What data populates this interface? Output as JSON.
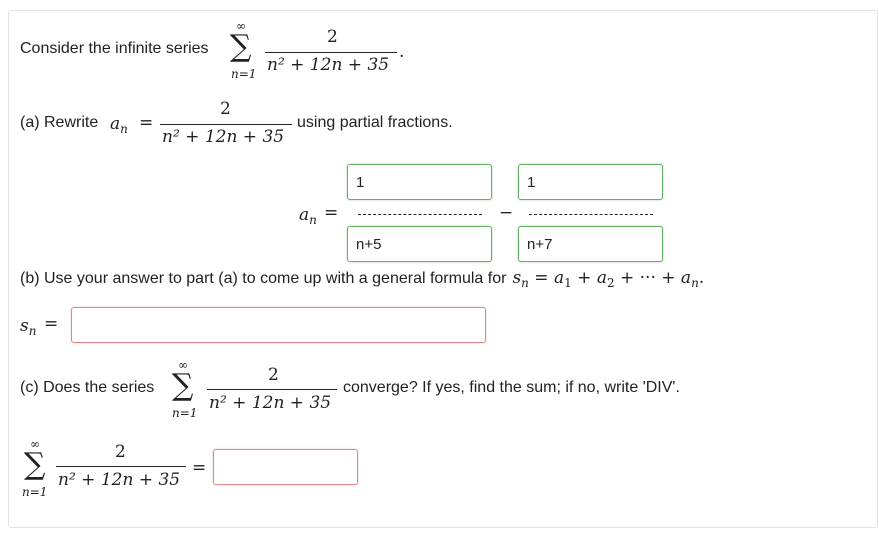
{
  "problem": {
    "intro_text": "Consider the infinite series",
    "series": {
      "sigma": "∑",
      "upper": "∞",
      "lower": "n=1",
      "numerator": "2",
      "denominator": "n² + 12n + 35"
    },
    "period": "."
  },
  "part_a": {
    "label": "(a) Rewrite",
    "a": "a",
    "n": "n",
    "equals": "=",
    "numerator": "2",
    "denominator": "n² + 12n + 35",
    "suffix": "using partial fractions.",
    "minus": "−",
    "inputs": {
      "num1": "1",
      "den1": "n+5",
      "num2": "1",
      "den2": "n+7"
    }
  },
  "part_b": {
    "text": "(b) Use your answer to part (a) to come up with a general formula for",
    "formula": "s",
    "formula_rest": " = a",
    "sn_label": "s",
    "equals": "=",
    "answer": ""
  },
  "part_c": {
    "prefix": "(c) Does the series",
    "suffix": "converge? If yes, find the sum; if no, write 'DIV'.",
    "numerator": "2",
    "denominator": "n² + 12n + 35",
    "upper": "∞",
    "lower": "n=1",
    "sigma": "∑",
    "equals": "=",
    "answer": ""
  },
  "colors": {
    "correct_border": "#63b163",
    "empty_border": "#d88888"
  }
}
